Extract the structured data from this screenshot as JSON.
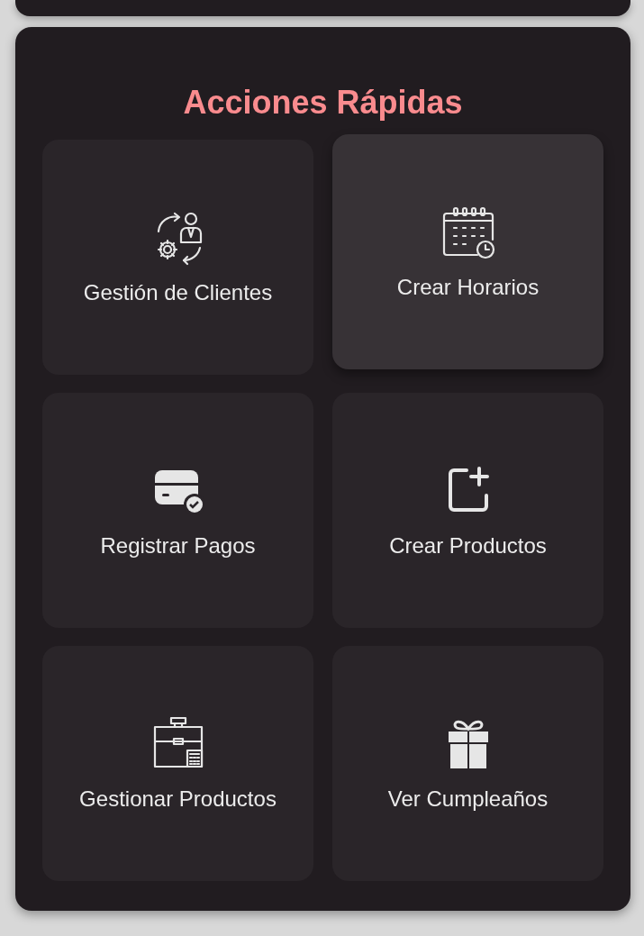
{
  "quick_actions": {
    "title": "Acciones Rápidas",
    "tiles": [
      {
        "label": "Gestión de Clientes",
        "highlighted": false
      },
      {
        "label": "Crear Horarios",
        "highlighted": true
      },
      {
        "label": "Registrar Pagos",
        "highlighted": false
      },
      {
        "label": "Crear Productos",
        "highlighted": false
      },
      {
        "label": "Gestionar Productos",
        "highlighted": false
      },
      {
        "label": "Ver Cumpleaños",
        "highlighted": false
      }
    ]
  }
}
